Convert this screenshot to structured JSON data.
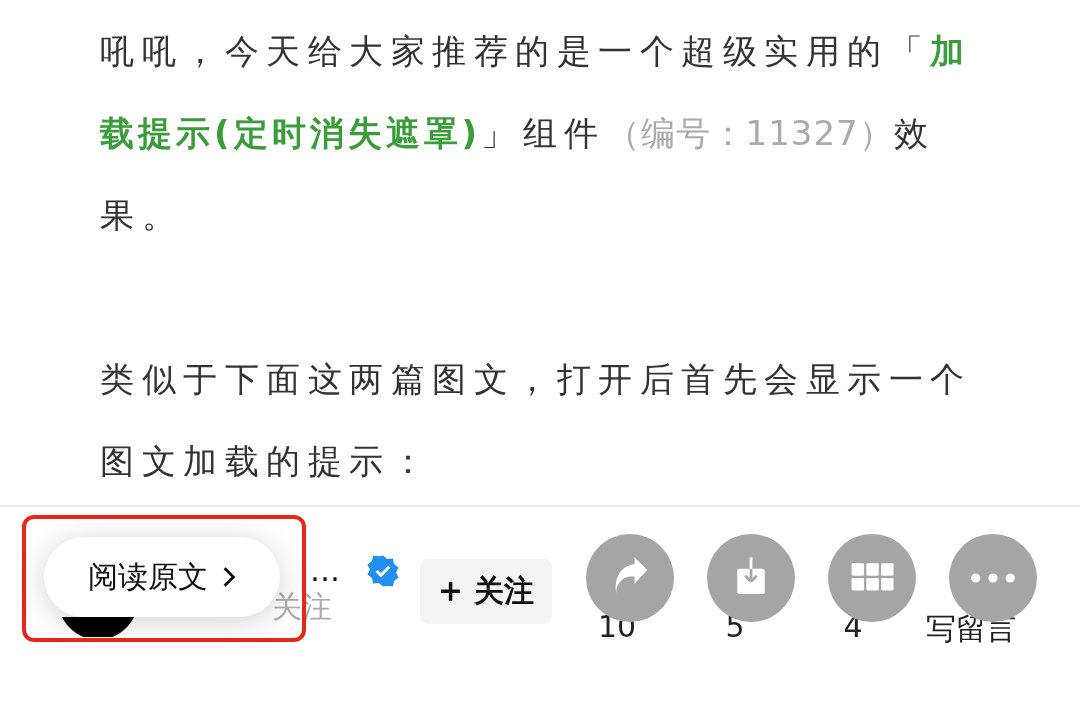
{
  "article": {
    "paragraphs": [
      {
        "segments": [
          {
            "kind": "text",
            "text": "吼吼，今天给大家推荐的是一个超级实用的「"
          },
          {
            "kind": "highlight",
            "text": "加载提示(定时消失遮罩)"
          },
          {
            "kind": "text",
            "text": "」组件"
          },
          {
            "kind": "muted",
            "text": "（编号：11327）"
          },
          {
            "kind": "text",
            "text": "效果。"
          }
        ]
      },
      {
        "segments": [
          {
            "kind": "text",
            "text": "类似于下面这两篇图文，打开后首先会显示一个图文加载的提示："
          }
        ]
      }
    ]
  },
  "bottom_bar": {
    "author": {
      "name": "…",
      "followers": "关注",
      "verified": true
    },
    "follow_button": "+ 关注",
    "stats": [
      {
        "count": "10"
      },
      {
        "count": "5"
      },
      {
        "count": "4"
      },
      {
        "count": "写留言"
      }
    ]
  },
  "overlay": {
    "read_original": "阅读原文",
    "highlighted": true,
    "actions": [
      {
        "kind": "share"
      },
      {
        "kind": "save"
      },
      {
        "kind": "grid"
      },
      {
        "kind": "more"
      }
    ]
  }
}
